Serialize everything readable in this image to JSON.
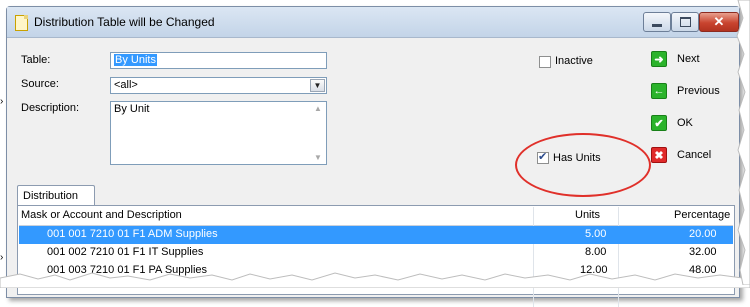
{
  "window": {
    "title": "Distribution Table will be Changed"
  },
  "form": {
    "table_label": "Table:",
    "table_value": "By Units",
    "source_label": "Source:",
    "source_value": "<all>",
    "description_label": "Description:",
    "description_value": "By Unit",
    "inactive_label": "Inactive",
    "inactive_checked": false,
    "has_units_label": "Has Units",
    "has_units_checked": true
  },
  "actions": [
    {
      "label": "Next",
      "icon": "arrow-right-icon",
      "color": "#2bb32b"
    },
    {
      "label": "Previous",
      "icon": "arrow-left-icon",
      "color": "#2bb32b"
    },
    {
      "label": "OK",
      "icon": "check-icon",
      "color": "#2bb32b"
    },
    {
      "label": "Cancel",
      "icon": "x-icon",
      "color": "#e02a2a"
    }
  ],
  "tabs": [
    {
      "label": "Distribution",
      "active": true
    }
  ],
  "grid": {
    "columns": [
      "Mask or Account and Description",
      "Units",
      "Percentage"
    ],
    "rows": [
      {
        "account": "001 001 7210 01 F1 ADM Supplies",
        "units": "5.00",
        "percentage": "20.00",
        "selected": true
      },
      {
        "account": "001 002 7210 01 F1 IT Supplies",
        "units": "8.00",
        "percentage": "32.00",
        "selected": false
      },
      {
        "account": "001 003 7210 01 F1 PA Supplies",
        "units": "12.00",
        "percentage": "48.00",
        "selected": false
      }
    ]
  },
  "colors": {
    "selection": "#3399ff",
    "highlight_ellipse": "#e0302a",
    "green_icon": "#2bb32b",
    "red_icon": "#e02a2a"
  }
}
